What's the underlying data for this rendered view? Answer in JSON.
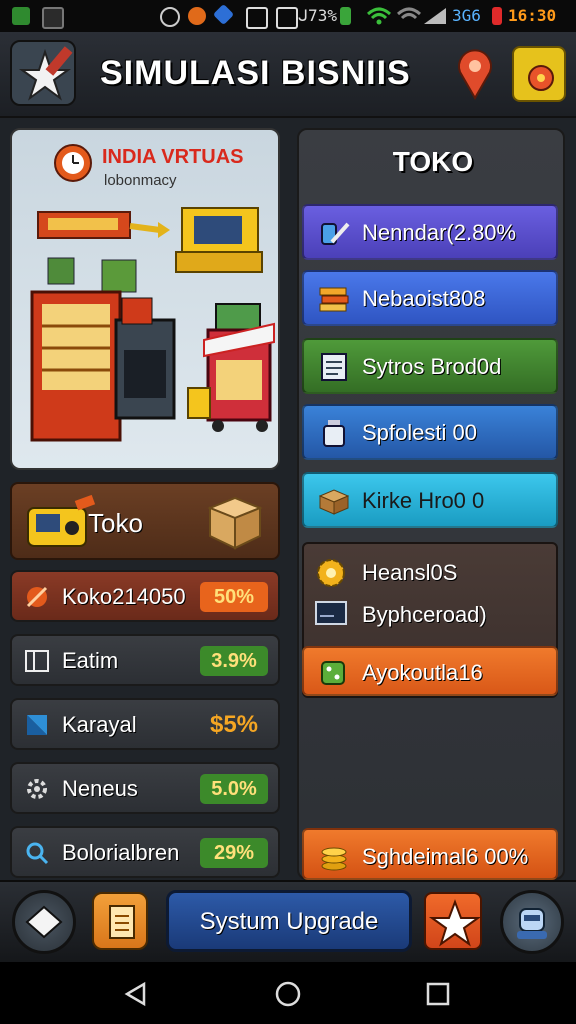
{
  "status_bar": {
    "signal_text": "ᒍ73%",
    "network_text": "3G6",
    "clock": "16:30"
  },
  "header": {
    "title": "SIMULASI BISNIIS"
  },
  "image_card": {
    "brand_title": "INDIA VRTUAS",
    "brand_subtitle": "lobonmacy"
  },
  "left": {
    "toko_label": "Toko",
    "rows": [
      {
        "label": "Koko214050",
        "badge": "50%",
        "badge_bg": "#e8641c",
        "icon": "comet-icon"
      },
      {
        "label": "Eatim",
        "badge": "3.9%",
        "badge_bg": "#3c8a2a",
        "icon": "grid-icon"
      },
      {
        "label": "Karayal",
        "badge": "$5%",
        "badge_bg": "transparent",
        "icon": "flag-icon"
      },
      {
        "label": "Neneus",
        "badge": "5.0%",
        "badge_bg": "#3c8a2a",
        "icon": "gear-icon"
      },
      {
        "label": "Bolorialbren",
        "badge": "29%",
        "badge_bg": "#3c8a2a",
        "icon": "search-icon"
      }
    ]
  },
  "right": {
    "title": "TOKO",
    "buttons": [
      {
        "label": "Nenndar(2.80%",
        "bg": "#5a4fc8",
        "icon": "tools-icon"
      },
      {
        "label": "Nebaoist808",
        "bg": "#3a63d6",
        "icon": "stack-icon"
      },
      {
        "label": "Sytros Brod0d",
        "bg": "#3d7d2e",
        "icon": "document-icon"
      },
      {
        "label": "Spfolesti 00",
        "bg": "#2f6bc2",
        "icon": "bottle-icon"
      },
      {
        "label": "Kirke Hro0 0",
        "bg": "#25b3d8",
        "icon": "box-icon"
      }
    ],
    "sub_group": {
      "item1": "Heansl0S",
      "item2": "Byphceroad)",
      "item3": "Ayokoutla16"
    },
    "bottom_button": "Sghdeimal6 00%"
  },
  "toolbar": {
    "upgrade_label": "Systum Upgrade"
  },
  "colors": {
    "accent_orange": "#e8641c",
    "accent_green": "#3c8a2a",
    "upgrade_blue": "#1f4a8c"
  }
}
